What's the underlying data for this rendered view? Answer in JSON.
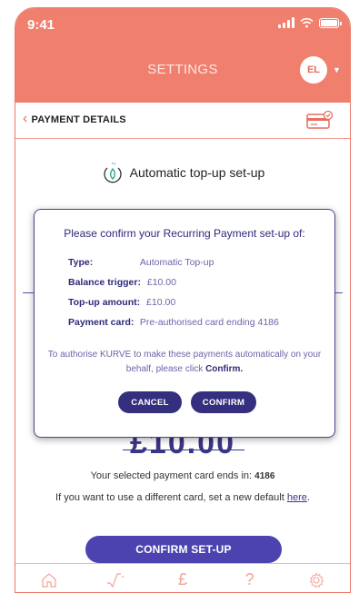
{
  "status": {
    "time": "9:41"
  },
  "header": {
    "title": "SETTINGS",
    "avatar_initials": "EL"
  },
  "subheader": {
    "back_label": "PAYMENT DETAILS"
  },
  "setup": {
    "heading": "Automatic top-up set-up",
    "amount_display": "£10.00"
  },
  "card_info": {
    "selected_prefix": "Your selected payment card ends in:",
    "selected_last4": "4186",
    "change_prefix": "If you want to use a different card, set a new default",
    "change_link": "here",
    "change_suffix": "."
  },
  "confirm_setup_label": "CONFIRM SET-UP",
  "modal": {
    "title": "Please confirm your Recurring Payment set-up of:",
    "rows": [
      {
        "key": "Type:",
        "value": "Automatic Top-up"
      },
      {
        "key": "Balance trigger:",
        "value": "£10.00"
      },
      {
        "key": "Top-up amount:",
        "value": "£10.00"
      },
      {
        "key": "Payment card:",
        "value": "Pre-authorised card ending 4186"
      }
    ],
    "message_prefix": "To authorise KURVE to make these payments automatically on your behalf, please click",
    "message_bold": "Confirm.",
    "cancel_label": "CANCEL",
    "confirm_label": "CONFIRM"
  },
  "tabbar": {
    "items": [
      {
        "icon": "home-icon"
      },
      {
        "icon": "graph-icon"
      },
      {
        "icon": "pound-icon",
        "glyph": "£"
      },
      {
        "icon": "help-icon",
        "glyph": "?"
      },
      {
        "icon": "settings-gear-icon"
      }
    ]
  },
  "colors": {
    "header": "#f07f6e",
    "accent": "#4d43b0",
    "modal_text": "#2f2a7a"
  }
}
